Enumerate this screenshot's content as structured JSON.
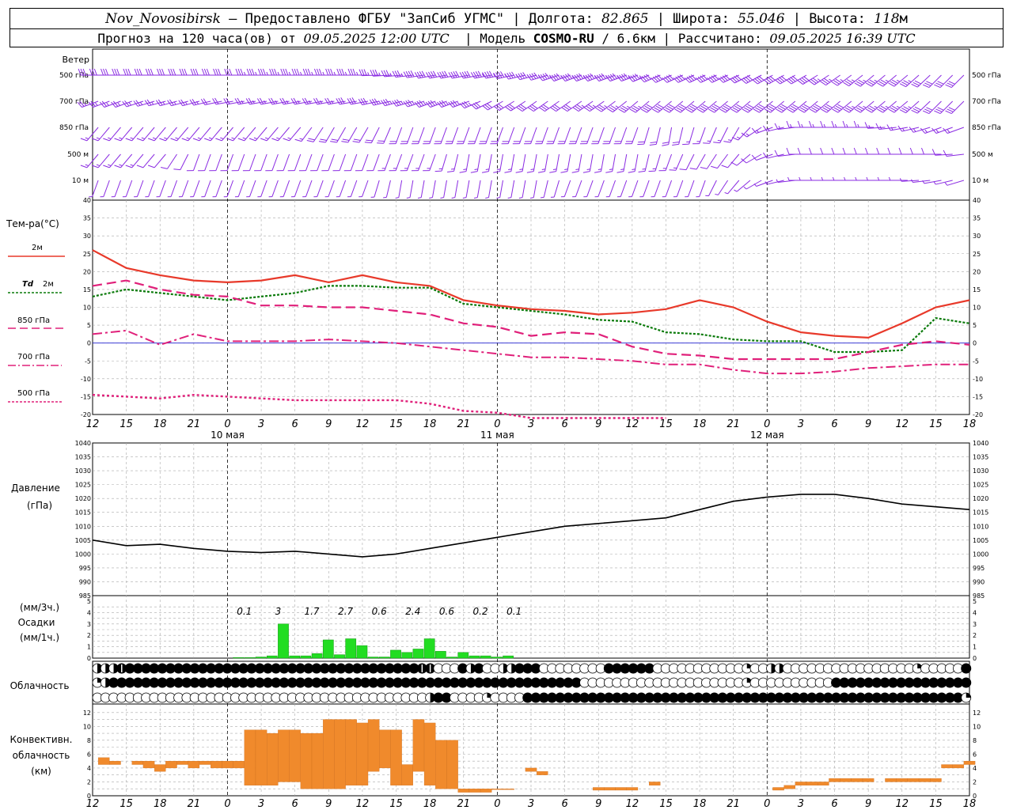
{
  "header": {
    "station": "Nov_Novosibirsk",
    "provided_by": " – Предоставлено ФГБУ \"ЗапСиб УГМС\" | Долгота: ",
    "lon": "82.865",
    "lat_label": " | Широта: ",
    "lat": "55.046",
    "alt_label": " | Высота: ",
    "alt": "118",
    "alt_unit": "м",
    "forecast_label": "Прогноз на 120 часа(ов) от ",
    "forecast_start": "09.05.2025 12:00 UTC",
    "model_label": "  | Модель ",
    "model": "COSMO-RU",
    "model_res": " / 6.6км | Рассчитано: ",
    "computed": "09.05.2025 16:39 UTC"
  },
  "labels": {
    "wind_title": "Ветер",
    "wind_levels": [
      "500 гПа",
      "700 гПа",
      "850 гПа",
      "500 м",
      "10  м"
    ],
    "temp_title": "Тем-ра(°C)",
    "t2m": "2м",
    "td": "Td",
    "td2m": "2м",
    "t850": "850 гПа",
    "t700": "700 гПа",
    "t500": "500 гПа",
    "pressure_title": "Давление",
    "pressure_unit": "(гПа)",
    "precip_3h": "(мм/3ч.)",
    "precip_title": "Осадки",
    "precip_1h": "(мм/1ч.)",
    "cloud_title": "Облачность",
    "conv_title1": "Конвективн.",
    "conv_title2": "облачность",
    "conv_unit": "(км)"
  },
  "colors": {
    "wind": "#8a2be2",
    "t2m": "#e8392a",
    "td": "#0a7a0a",
    "t850": "#e0207a",
    "t700": "#e0207a",
    "t500": "#e0207a",
    "zero": "#2020d0",
    "pressure": "#000000",
    "precip": "#22dd22",
    "conv": "#f08a2c"
  },
  "time_axis": {
    "ticks": [
      "12",
      "15",
      "18",
      "21",
      "0",
      "3",
      "6",
      "9",
      "12",
      "15",
      "18",
      "21",
      "0",
      "3",
      "6",
      "9",
      "12",
      "15",
      "18",
      "21",
      "0",
      "3",
      "6",
      "9",
      "12",
      "15",
      "18"
    ],
    "dates": [
      "10 мая",
      "11 мая",
      "12 мая"
    ]
  },
  "chart_data": [
    {
      "type": "line",
      "title": "Тем-ра(°C)",
      "x_hours": [
        0,
        3,
        6,
        9,
        12,
        15,
        18,
        21,
        24,
        27,
        30,
        33,
        36,
        39,
        42,
        45,
        48,
        51,
        54,
        57,
        60,
        63,
        66,
        69,
        72,
        75,
        78
      ],
      "ylim": [
        -20,
        40
      ],
      "series": [
        {
          "name": "2м",
          "values": [
            26,
            21,
            19,
            17.5,
            17,
            17.5,
            19,
            17,
            19,
            17,
            16,
            12,
            10.5,
            9.5,
            9,
            8,
            8.5,
            9.5,
            12,
            10,
            6,
            3,
            2,
            1.5,
            5.5,
            10,
            12
          ]
        },
        {
          "name": "Td 2м",
          "values": [
            13,
            15,
            14,
            13,
            12,
            13,
            14,
            16,
            16,
            15.5,
            15.5,
            11,
            10,
            9,
            8,
            6.5,
            6,
            3,
            2.5,
            1,
            0.5,
            0.5,
            -2.5,
            -2.5,
            -2,
            7,
            5.5
          ]
        },
        {
          "name": "850 гПа",
          "values": [
            16,
            17.5,
            15,
            13.5,
            13,
            10.5,
            10.5,
            10,
            10,
            9,
            8,
            5.5,
            4.5,
            2,
            3,
            2.5,
            -1,
            -3,
            -3.5,
            -4.5,
            -4.5,
            -4.5,
            -4.5,
            -2.5,
            -0.5,
            0.5,
            -0.5
          ]
        },
        {
          "name": "700 гПа",
          "values": [
            2.5,
            3.5,
            -0.5,
            2.5,
            0.5,
            0.5,
            0.5,
            1,
            0.5,
            0,
            -1,
            -2,
            -3,
            -4,
            -4,
            -4.5,
            -5,
            -6,
            -6,
            -7.5,
            -8.5,
            -8.5,
            -8,
            -7,
            -6.5,
            -6,
            -6
          ]
        },
        {
          "name": "500 гПа",
          "values": [
            -14.5,
            -15,
            -15.5,
            -14.5,
            -15,
            -15.5,
            -16,
            -16,
            -16,
            -16,
            -17,
            -19,
            -19.5,
            -21,
            -21,
            -21,
            -21,
            -21,
            null,
            null,
            null,
            null,
            null,
            null,
            null,
            null,
            null
          ]
        }
      ]
    },
    {
      "type": "line",
      "title": "Давление",
      "ylabel": "(гПа)",
      "ylim": [
        985,
        1040
      ],
      "x_hours": [
        0,
        3,
        6,
        9,
        12,
        15,
        18,
        21,
        24,
        27,
        30,
        33,
        36,
        39,
        42,
        45,
        48,
        51,
        54,
        57,
        60,
        63,
        66,
        69,
        72,
        75,
        78
      ],
      "values": [
        1005,
        1003,
        1003.5,
        1002,
        1001,
        1000.5,
        1001,
        1000,
        999,
        1000,
        1002,
        1004,
        1006,
        1008,
        1010,
        1011,
        1012,
        1013,
        1016,
        1019,
        1020.5,
        1021.5,
        1021.5,
        1020,
        1018,
        1017,
        1016
      ]
    },
    {
      "type": "bar",
      "title": "Осадки",
      "ylim": [
        0,
        5
      ],
      "x_hours": [
        13,
        14,
        15,
        16,
        17,
        18,
        19,
        20,
        21,
        22,
        23,
        24,
        25,
        26,
        27,
        28,
        29,
        30,
        31,
        32,
        33,
        34,
        35,
        36,
        37
      ],
      "values": [
        0.05,
        0.05,
        0.1,
        0.2,
        3,
        0.2,
        0.2,
        0.4,
        1.6,
        0.3,
        1.7,
        1.1,
        0.1,
        0.1,
        0.7,
        0.5,
        0.8,
        1.7,
        0.6,
        0.1,
        0.5,
        0.2,
        0.2,
        0.1,
        0.2
      ],
      "totals_3h": [
        {
          "hour": 13.5,
          "label": "0.1"
        },
        {
          "hour": 16.5,
          "label": "3"
        },
        {
          "hour": 19.5,
          "label": "1.7"
        },
        {
          "hour": 22.5,
          "label": "2.7"
        },
        {
          "hour": 25.5,
          "label": "0.6"
        },
        {
          "hour": 28.5,
          "label": "2.4"
        },
        {
          "hour": 31.5,
          "label": "0.6"
        },
        {
          "hour": 34.5,
          "label": "0.2"
        },
        {
          "hour": 37.5,
          "label": "0.1"
        }
      ]
    },
    {
      "type": "bar",
      "title": "Конвективн. облачность (км)",
      "ylim": [
        0,
        13
      ],
      "x_hours": [
        1,
        2,
        4,
        5,
        6,
        7,
        8,
        9,
        10,
        11,
        12,
        13,
        14,
        15,
        16,
        17,
        18,
        19,
        20,
        21,
        22,
        23,
        24,
        25,
        26,
        27,
        28,
        29,
        30,
        31,
        32,
        33,
        34,
        35,
        36,
        37,
        39,
        40,
        45,
        46,
        47,
        48,
        50,
        61,
        62,
        63,
        64,
        65,
        66,
        67,
        68,
        69,
        71,
        72,
        73,
        74,
        75,
        76,
        77,
        78
      ],
      "base": [
        4.5,
        4.5,
        4.5,
        4,
        3.5,
        4,
        4.5,
        4,
        4.5,
        4,
        4,
        4,
        1.5,
        1.5,
        1.5,
        2,
        2,
        1,
        1,
        1,
        1,
        1.5,
        1.5,
        3.5,
        4,
        1.5,
        1.5,
        3.5,
        1.5,
        1,
        1,
        0.5,
        0.5,
        0.5,
        1,
        1,
        3.5,
        3,
        0.8,
        0.8,
        0.8,
        0.8,
        1.5,
        0.8,
        1,
        1.5,
        1.5,
        1.5,
        2,
        2,
        2,
        2,
        2,
        2,
        2,
        2,
        2,
        4,
        4,
        4.5
      ],
      "top": [
        5.5,
        5,
        5,
        5,
        4.5,
        5,
        5,
        5,
        5,
        5,
        5,
        5,
        9.5,
        9.5,
        9,
        9.5,
        9.5,
        9,
        9,
        11,
        11,
        11,
        10.5,
        11,
        9.5,
        9.5,
        4.5,
        11,
        10.5,
        8,
        8,
        1,
        1,
        1,
        1,
        1,
        4,
        3.5,
        1.2,
        1.2,
        1.2,
        1.2,
        2,
        1.2,
        1.5,
        2,
        2,
        2,
        2.5,
        2.5,
        2.5,
        2.5,
        2.5,
        2.5,
        2.5,
        2.5,
        2.5,
        4.5,
        4.5,
        5
      ],
      "xlim_hours": [
        0,
        78
      ]
    }
  ],
  "cloud_symbols": {
    "rows": [
      "HHHDFFFFFFFFFFFFFFFFFFFFFFFFFFFFFFFFFFFFDDEEEFHFEEHHFFFEEEEEEEEFFFFFFEEEEEEEEEEEQEEHHEEEEEEEEEEEEEEEEQEEEEEF",
      "QTFFFFFFFFFFFFFFFFFFFFFFFFFFFFFFFFFFFFFFFFFFFFFFFFFFFFFFFFFFEEEEEEEEEEEEEEEEEEEEQEEEEEEEEEEFFFFFFFFFFFFFFFFF",
      "EEEEEEEEEEEEEEEEEEEEEEEEEEEEEEEEEEEEEEEEEHFFEEEEQEEEEFFFFFFFFFFFFFFFFFFFFFFFFFFFFFFFFFFFFFFFFFFFFFFFFFFFFFFQ"
    ]
  },
  "wind_barbs": {
    "note_levels": [
      "500 гПа",
      "700 гПа",
      "850 гПа",
      "500 м",
      "10  м"
    ],
    "rows": [
      {
        "speed_kt": [
          30,
          30,
          30,
          30,
          30,
          35,
          35,
          35,
          35,
          35,
          40,
          40,
          45,
          45,
          45,
          45,
          45,
          40,
          40,
          40,
          40,
          40,
          35,
          35,
          35,
          30,
          30
        ],
        "dir_deg": [
          270,
          270,
          270,
          270,
          270,
          270,
          270,
          270,
          270,
          265,
          260,
          260,
          260,
          255,
          250,
          250,
          250,
          245,
          245,
          245,
          240,
          240,
          235,
          230,
          230,
          225,
          225
        ]
      },
      {
        "speed_kt": [
          25,
          25,
          25,
          25,
          20,
          25,
          25,
          25,
          30,
          35,
          35,
          35,
          30,
          30,
          30,
          35,
          35,
          40,
          40,
          40,
          40,
          40,
          40,
          35,
          35,
          30,
          30
        ],
        "dir_deg": [
          250,
          250,
          255,
          255,
          260,
          260,
          260,
          260,
          260,
          255,
          250,
          250,
          240,
          235,
          235,
          235,
          230,
          230,
          230,
          230,
          230,
          230,
          230,
          230,
          230,
          225,
          225
        ]
      },
      {
        "speed_kt": [
          15,
          15,
          15,
          15,
          15,
          15,
          15,
          20,
          20,
          20,
          20,
          20,
          20,
          20,
          20,
          20,
          20,
          20,
          15,
          15,
          15,
          15,
          15,
          15,
          15,
          15,
          15
        ],
        "dir_deg": [
          220,
          220,
          220,
          220,
          220,
          220,
          220,
          210,
          210,
          200,
          200,
          200,
          200,
          200,
          200,
          200,
          200,
          190,
          200,
          210,
          250,
          270,
          270,
          270,
          260,
          250,
          250
        ]
      },
      {
        "speed_kt": [
          15,
          15,
          10,
          10,
          10,
          10,
          10,
          10,
          10,
          15,
          15,
          15,
          15,
          15,
          15,
          15,
          15,
          15,
          10,
          10,
          10,
          10,
          10,
          10,
          10,
          10,
          10
        ],
        "dir_deg": [
          220,
          220,
          220,
          200,
          200,
          200,
          200,
          200,
          200,
          200,
          200,
          190,
          190,
          190,
          190,
          190,
          190,
          200,
          210,
          220,
          250,
          270,
          270,
          270,
          270,
          270,
          260
        ]
      },
      {
        "speed_kt": [
          5,
          5,
          5,
          5,
          5,
          5,
          5,
          5,
          5,
          5,
          5,
          5,
          5,
          5,
          5,
          5,
          5,
          5,
          5,
          5,
          5,
          5,
          5,
          5,
          5,
          5,
          5
        ],
        "dir_deg": [
          200,
          200,
          200,
          200,
          200,
          200,
          200,
          200,
          200,
          190,
          190,
          190,
          190,
          190,
          200,
          200,
          200,
          200,
          200,
          220,
          250,
          270,
          270,
          270,
          270,
          260,
          250
        ]
      }
    ]
  }
}
